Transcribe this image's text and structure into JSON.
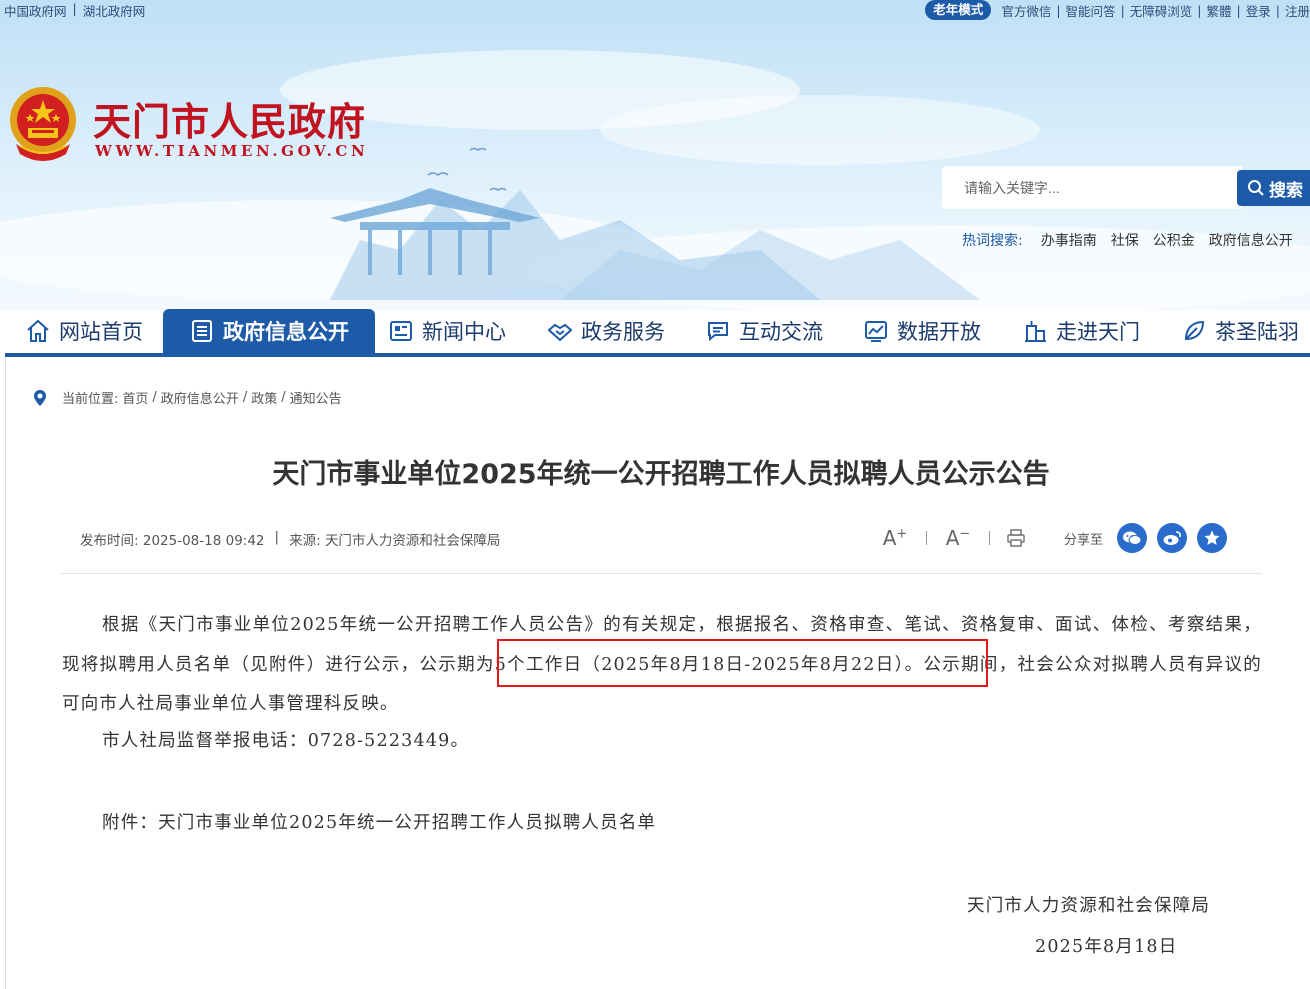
{
  "top_links": [
    "中国政府网",
    "湖北政府网"
  ],
  "toolbar": {
    "elder_mode": "老年模式",
    "items": [
      "官方微信",
      "智能问答",
      "无障碍浏览",
      "繁體",
      "登录",
      "注册"
    ]
  },
  "site": {
    "title": "天门市人民政府",
    "domain": "WWW.TIANMEN.GOV.CN",
    "brand_color": "#c1121f",
    "accent_color": "#1d5aa8"
  },
  "search": {
    "placeholder": "请输入关键字...",
    "button_label": "搜索",
    "hot_label": "热词搜索:",
    "hot_words": [
      "办事指南",
      "社保",
      "公积金",
      "政府信息公开"
    ]
  },
  "nav": {
    "items": [
      {
        "label": "网站首页",
        "icon": "home-icon"
      },
      {
        "label": "政府信息公开",
        "icon": "list-icon",
        "active": true
      },
      {
        "label": "新闻中心",
        "icon": "newspaper-icon"
      },
      {
        "label": "政务服务",
        "icon": "handshake-icon"
      },
      {
        "label": "互动交流",
        "icon": "chat-icon"
      },
      {
        "label": "数据开放",
        "icon": "chart-icon"
      },
      {
        "label": "走进天门",
        "icon": "building-icon"
      },
      {
        "label": "茶圣陆羽",
        "icon": "leaf-icon"
      }
    ]
  },
  "breadcrumb": {
    "prefix": "当前位置:",
    "items": [
      "首页",
      "政府信息公开",
      "政策",
      "通知公告"
    ]
  },
  "article": {
    "title": "天门市事业单位2025年统一公开招聘工作人员拟聘人员公示公告",
    "publish_label": "发布时间:",
    "publish_time": "2025-08-18 09:42",
    "source_label": "来源:",
    "source": "天门市人力资源和社会保障局",
    "share_label": "分享至",
    "para1_a": "根据《天门市事业单位2025年统一公开招聘工作人员公告》的有关规定，根据报名、资格审查、笔试、资格复审、面试、体检、考察结果，现将拟聘用人员名单（见附件）进行公示，",
    "para1_b": "公示期为5个工作日（2025年8月18日-2025年8月22日）",
    "para1_c": "。公示期间，社会公众对拟聘人员有异议的可向市人社局事业单位人事管理科反映。",
    "para2": "市人社局监督举报电话：0728-5223449。",
    "attachment": "附件：天门市事业单位2025年统一公开招聘工作人员拟聘人员名单",
    "signature_org": "天门市人力资源和社会保障局",
    "signature_date": "2025年8月18日"
  }
}
